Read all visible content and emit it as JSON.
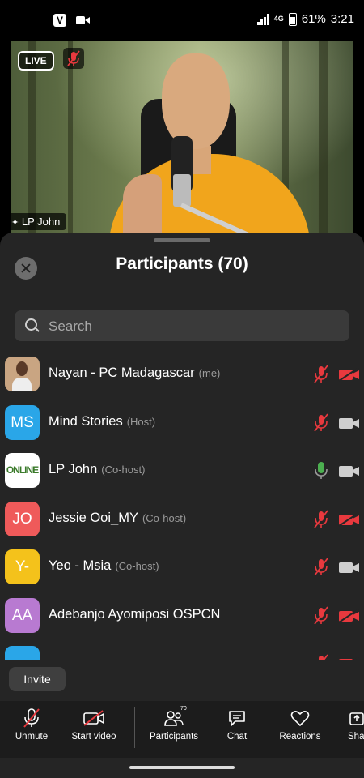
{
  "status_bar": {
    "network": "4G",
    "battery": "61%",
    "time": "3:21"
  },
  "video": {
    "live_badge": "LIVE",
    "speaker_name": "LP John"
  },
  "panel": {
    "title": "Participants (70)",
    "search_placeholder": "Search",
    "participants": [
      {
        "name": "Nayan - PC Madagascar",
        "role": "(me)",
        "initials": "",
        "avatar_color": "#c9a582",
        "mic": "muted",
        "video": "off"
      },
      {
        "name": "Mind Stories",
        "role": "(Host)",
        "initials": "MS",
        "avatar_color": "#2aa6e8",
        "mic": "muted",
        "video": "on"
      },
      {
        "name": "LP John",
        "role": "(Co-host)",
        "initials": "",
        "avatar_label": "ONLINE",
        "avatar_color": "#ffffff",
        "mic": "active",
        "video": "on"
      },
      {
        "name": "Jessie Ooi_MY",
        "role": "(Co-host)",
        "initials": "JO",
        "avatar_color": "#ef5a5a",
        "mic": "muted",
        "video": "off"
      },
      {
        "name": "Yeo - Msia",
        "role": "(Co-host)",
        "initials": "Y-",
        "avatar_color": "#f4c21b",
        "mic": "muted",
        "video": "on"
      },
      {
        "name": "Adebanjo Ayomiposi OSPCN",
        "role": "",
        "initials": "AA",
        "avatar_color": "#b87ad1",
        "mic": "muted",
        "video": "off"
      },
      {
        "name": "",
        "role": "",
        "initials": "",
        "avatar_color": "#2aa6e8",
        "mic": "muted",
        "video": "off"
      }
    ],
    "invite_label": "Invite"
  },
  "toolbar": {
    "unmute_label": "Unmute",
    "start_video_label": "Start video",
    "participants_label": "Participants",
    "participants_count": "70",
    "chat_label": "Chat",
    "reactions_label": "Reactions",
    "share_label": "Sha"
  },
  "colors": {
    "muted_red": "#e8393e",
    "active_green": "#4caf50",
    "icon_gray": "#cfcfcf"
  }
}
